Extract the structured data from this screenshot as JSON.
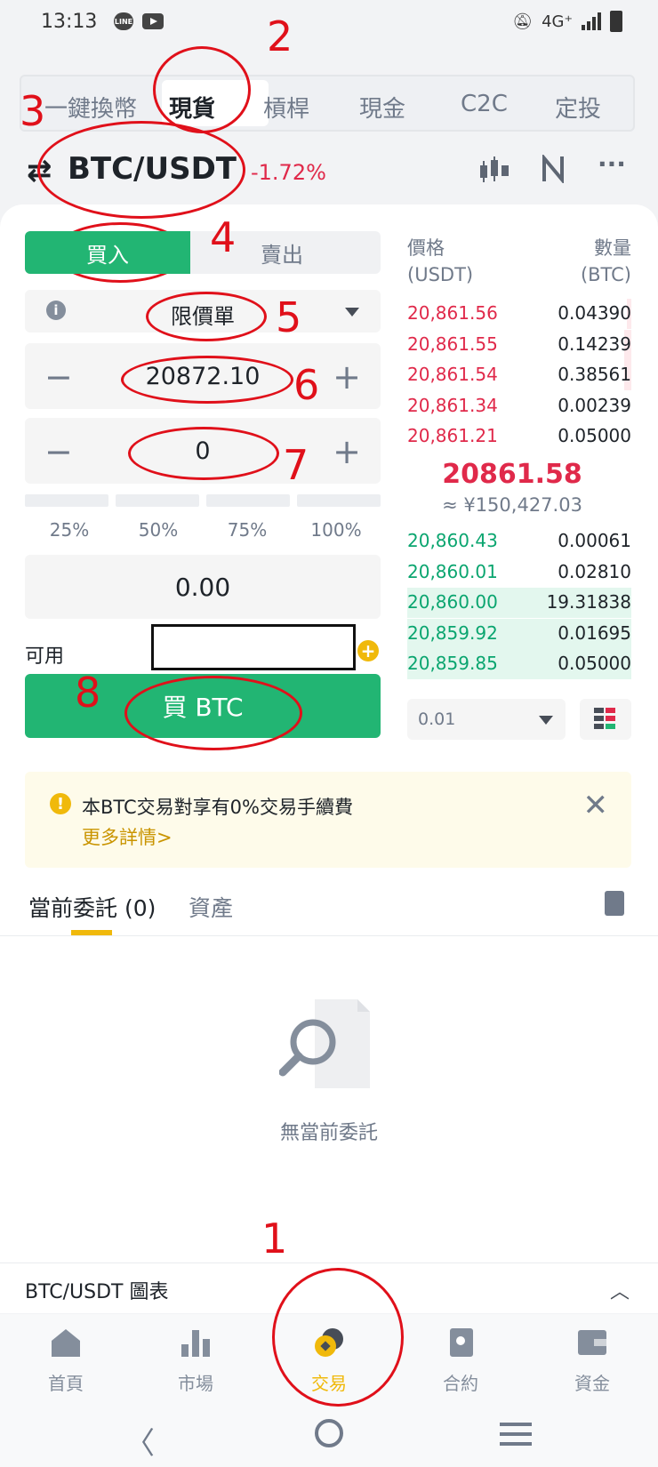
{
  "status_bar": {
    "time": "13:13",
    "line_badge": "LINE",
    "network": "4G⁺"
  },
  "top_tabs": [
    "一鍵換幣",
    "現貨",
    "槓桿",
    "現金",
    "C2C",
    "定投"
  ],
  "pair": {
    "name": "BTC/USDT",
    "change": "-1.72%"
  },
  "trade": {
    "buy_label": "買入",
    "sell_label": "賣出",
    "order_type": "限價單",
    "price": "20872.10",
    "amount": "0",
    "percentages": [
      "25%",
      "50%",
      "75%",
      "100%"
    ],
    "total": "0.00",
    "available_label": "可用",
    "buy_button": "買 BTC"
  },
  "order_book": {
    "price_header": "價格",
    "price_unit": "(USDT)",
    "qty_header": "數量",
    "qty_unit": "(BTC)",
    "asks": [
      {
        "price": "20,861.56",
        "qty": "0.04390",
        "depth": 0.02
      },
      {
        "price": "20,861.55",
        "qty": "0.14239",
        "depth": 0.03
      },
      {
        "price": "20,861.54",
        "qty": "0.38561",
        "depth": 0.03
      },
      {
        "price": "20,861.34",
        "qty": "0.00239",
        "depth": 0.0
      },
      {
        "price": "20,861.21",
        "qty": "0.05000",
        "depth": 0.0
      }
    ],
    "last_price": "20861.58",
    "last_price_fiat": "≈ ¥150,427.03",
    "bids": [
      {
        "price": "20,860.43",
        "qty": "0.00061",
        "depth": 0.0
      },
      {
        "price": "20,860.01",
        "qty": "0.02810",
        "depth": 0.0
      },
      {
        "price": "20,860.00",
        "qty": "19.31838",
        "depth": 1.0
      },
      {
        "price": "20,859.92",
        "qty": "0.01695",
        "depth": 1.0
      },
      {
        "price": "20,859.85",
        "qty": "0.05000",
        "depth": 1.0
      }
    ],
    "depth_value": "0.01"
  },
  "notice": {
    "text": "本BTC交易對享有0%交易手續費",
    "more": "更多詳情>"
  },
  "orders": {
    "tab_open": "當前委託 (0)",
    "tab_assets": "資產",
    "empty": "無當前委託"
  },
  "chart_bar": {
    "label": "BTC/USDT 圖表"
  },
  "bottom_nav": [
    "首頁",
    "市場",
    "交易",
    "合約",
    "資金"
  ],
  "annotations": [
    "1",
    "2",
    "3",
    "4",
    "5",
    "6",
    "7",
    "8"
  ],
  "colors": {
    "buy": "#22b573",
    "sell": "#e0294a",
    "accent": "#f0b90b",
    "annotation": "#e0101a"
  }
}
